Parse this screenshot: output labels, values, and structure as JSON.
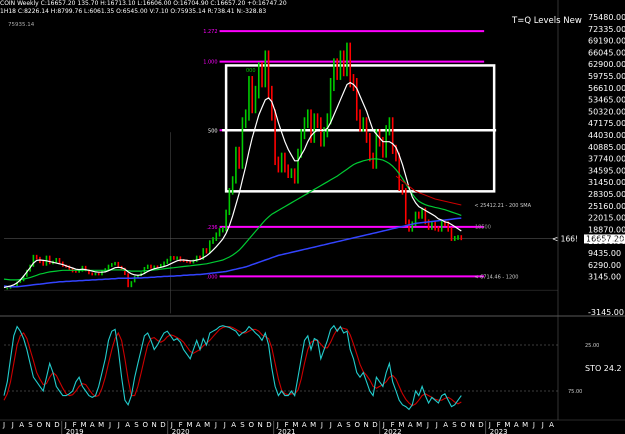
{
  "header": {
    "line1": "COIN Weekly C:16657.20 135.70 H:16713.10 L:16606.00 O:16704.90 C:16657.20 +0:16747.20",
    "line2": "1H18 C:8226.14 H:8799.76 L:6061.35 O:6545.00 V:7.10 O:75935.14 R:738.41 N:-328.83",
    "line3": "75935.14"
  },
  "title_label": "T=Q Levels New",
  "price_axis": {
    "ticks": [
      "75480.00",
      "72335.00",
      "69190.00",
      "66045.00",
      "62900.00",
      "59755.00",
      "56610.00",
      "53465.00",
      "50320.00",
      "47175.00",
      "44030.00",
      "40885.00",
      "37740.00",
      "34595.00",
      "31450.00",
      "28305.00",
      "25160.00",
      "22015.00",
      "18870.00",
      "16657.20",
      "12580.00",
      "9435.00",
      "6290.00",
      "3145.00",
      "-3145.00"
    ],
    "current_price_label": "16657.20",
    "pointer_label": "< 166!"
  },
  "level_labels": {
    "l1272": "1.272",
    "l1000": "1.000",
    "l500": "500",
    "l236": ".236",
    "l000": ".000",
    "misc": "000"
  },
  "annotations": {
    "sma200": "< 25412.21 - 200 SMA",
    "low_level": "< 6714.46 - 1200",
    "box_text": "18500"
  },
  "oscillator": {
    "label": "STO",
    "value": "24.2",
    "ticks": [
      "25.00",
      "75.00"
    ]
  },
  "time_axis": {
    "months": [
      "J",
      "J",
      "A",
      "S",
      "O",
      "N",
      "D",
      "J",
      "F",
      "M",
      "A",
      "M",
      "J",
      "J",
      "A",
      "S",
      "O",
      "N",
      "D",
      "J",
      "F",
      "M",
      "A",
      "M",
      "J",
      "J",
      "A",
      "S",
      "O",
      "N",
      "D",
      "J",
      "F",
      "M",
      "A",
      "M",
      "J",
      "J",
      "A",
      "S",
      "O",
      "N",
      "D",
      "J",
      "F",
      "M",
      "A",
      "M",
      "J",
      "J",
      "A",
      "S",
      "O",
      "N",
      "D",
      "J",
      "F",
      "M",
      "A",
      "M",
      "J",
      "J",
      "A"
    ],
    "years": [
      "2019",
      "2020",
      "2021",
      "2022",
      "2023"
    ]
  },
  "colors": {
    "price_up": "#00cc00",
    "price_down": "#ff0000",
    "sma_fast": "#ffffff",
    "sma_slow": "#00cc33",
    "sma200": "#cc0000",
    "long_ma": "#3344ff",
    "fib": "#ff00ff",
    "stoch_k": "#22cccc",
    "stoch_d": "#cc0000"
  },
  "chart_data": {
    "type": "line",
    "series": [
      {
        "values": [
          3400,
          3600,
          3900,
          4100,
          5200,
          5600,
          6800,
          8200,
          9500,
          12000,
          11500,
          10500,
          9800,
          11800,
          10200,
          10500,
          11200,
          10300,
          9500,
          9300,
          8700,
          8000,
          7900,
          8200,
          9200,
          8300,
          7500,
          7200,
          7400,
          7200,
          8000,
          8600,
          9500,
          9900,
          10200,
          9200,
          8700,
          7300,
          4000,
          5300,
          6600,
          7000,
          7500,
          8900,
          9500,
          9000,
          9300,
          9200,
          9700,
          10300,
          11000,
          11700,
          11400,
          11600,
          10900,
          10800,
          10600,
          10400,
          10800,
          11800,
          11400,
          13700,
          13100,
          15700,
          16500,
          17700,
          18800,
          19100,
          23500,
          29000,
          32000,
          39500,
          36000,
          47000,
          49000,
          57500,
          51000,
          55000,
          61000,
          58000,
          64000,
          55000,
          49000,
          37000,
          35000,
          38000,
          35000,
          33500,
          34000,
          32000,
          39000,
          44000,
          47000,
          49000,
          43000,
          48000,
          47000,
          42000,
          44500,
          48000,
          57000,
          62000,
          60000,
          64000,
          61000,
          66000,
          58000,
          57000,
          49000,
          46000,
          47000,
          43000,
          38000,
          36000,
          44000,
          42000,
          39000,
          45000,
          47000,
          40000,
          38000,
          30000,
          29000,
          21000,
          19000,
          20500,
          23000,
          22500,
          24000,
          21000,
          19500,
          20500,
          19300,
          19000,
          21000,
          20500,
          19000,
          16500,
          16800,
          17000,
          16700
        ]
      },
      {
        "values": [
          3800,
          4000,
          4200,
          4500,
          5000,
          5800,
          6800,
          7900,
          9000,
          10200,
          10900,
          11000,
          10900,
          10800,
          10600,
          10400,
          10200,
          10000,
          9800,
          9500,
          9200,
          8900,
          8600,
          8500,
          8600,
          8500,
          8300,
          8100,
          7900,
          7800,
          7800,
          7900,
          8200,
          8600,
          9000,
          9100,
          9000,
          8600,
          7900,
          7400,
          7100,
          7000,
          7100,
          7500,
          8000,
          8400,
          8700,
          8900,
          9100,
          9300,
          9600,
          10000,
          10400,
          10800,
          11000,
          11000,
          10900,
          10800,
          10800,
          11000,
          11200,
          11600,
          12100,
          12800,
          13600,
          14500,
          15500,
          16500,
          18000,
          20000,
          22500,
          25500,
          28500,
          32000,
          35500,
          39500,
          43000,
          46000,
          49000,
          51000,
          53000,
          53500,
          52500,
          50000,
          47000,
          44500,
          42000,
          40000,
          38500,
          37000,
          37000,
          38500,
          40000,
          42000,
          43500,
          44500,
          45000,
          45000,
          45000,
          45500,
          47000,
          49000,
          51000,
          53000,
          55000,
          57000,
          57500,
          57000,
          56000,
          54000,
          52000,
          50000,
          47500,
          45000,
          44000,
          43000,
          42000,
          42000,
          42000,
          41500,
          40500,
          38500,
          36000,
          33000,
          30000,
          27500,
          26000,
          25000,
          24500,
          24000,
          23500,
          23000,
          22500,
          21800,
          21500,
          21000,
          20800,
          20300,
          19800,
          19200,
          18600
        ]
      },
      {
        "values": [
          6000,
          5900,
          5800,
          5800,
          5800,
          5900,
          6000,
          6200,
          6400,
          6700,
          7000,
          7300,
          7500,
          7700,
          7900,
          8000,
          8100,
          8200,
          8300,
          8300,
          8300,
          8300,
          8300,
          8300,
          8300,
          8300,
          8300,
          8300,
          8300,
          8300,
          8300,
          8300,
          8300,
          8400,
          8400,
          8400,
          8400,
          8300,
          8200,
          8100,
          8100,
          8100,
          8100,
          8200,
          8200,
          8300,
          8400,
          8500,
          8600,
          8700,
          8800,
          8900,
          9000,
          9100,
          9200,
          9300,
          9400,
          9500,
          9600,
          9700,
          9800,
          9900,
          10000,
          10200,
          10400,
          10600,
          10800,
          11000,
          11400,
          11800,
          12300,
          12900,
          13600,
          14500,
          15500,
          16500,
          17500,
          18500,
          19500,
          20500,
          21500,
          22300,
          23000,
          23500,
          24000,
          24500,
          25000,
          25500,
          26000,
          26500,
          27000,
          27500,
          28000,
          28500,
          29000,
          29500,
          30000,
          30500,
          31000,
          31500,
          32000,
          32500,
          33000,
          33600,
          34200,
          34800,
          35400,
          36000,
          36400,
          36700,
          37000,
          37200,
          37400,
          37500,
          37500,
          37400,
          37200,
          36800,
          36300,
          35600,
          34700,
          33600,
          32400,
          31000,
          29600,
          28300,
          27200,
          26400,
          25900,
          25500,
          25200,
          25000,
          24800,
          24600,
          24400,
          24200,
          23900,
          23600,
          23300,
          23000,
          22700
        ]
      },
      {
        "values": [
          4200,
          4100,
          4000,
          4000,
          4000,
          4100,
          4200,
          4300,
          4400,
          4500,
          4600,
          4700,
          4800,
          4900,
          5000,
          5100,
          5200,
          5300,
          5300,
          5400,
          5400,
          5500,
          5500,
          5600,
          5600,
          5700,
          5700,
          5800,
          5800,
          5900,
          5900,
          6000,
          6000,
          6100,
          6100,
          6200,
          6200,
          6200,
          6200,
          6200,
          6300,
          6300,
          6300,
          6400,
          6400,
          6500,
          6500,
          6600,
          6600,
          6700,
          6700,
          6800,
          6800,
          6900,
          6900,
          7000,
          7000,
          7100,
          7100,
          7200,
          7200,
          7300,
          7400,
          7500,
          7600,
          7700,
          7800,
          7900,
          8000,
          8200,
          8400,
          8600,
          8800,
          9000,
          9200,
          9500,
          9800,
          10100,
          10400,
          10700,
          11000,
          11300,
          11600,
          11900,
          12200,
          12400,
          12600,
          12800,
          13000,
          13200,
          13400,
          13600,
          13800,
          14000,
          14200,
          14400,
          14600,
          14800,
          15000,
          15200,
          15400,
          15600,
          15800,
          16000,
          16200,
          16400,
          16600,
          16800,
          17000,
          17200,
          17400,
          17600,
          17800,
          18000,
          18200,
          18400,
          18600,
          18800,
          19000,
          19200,
          19400,
          19600,
          19800,
          20000,
          20200,
          20400,
          20600,
          20700,
          20800,
          20900,
          21000,
          21100,
          21200,
          21300,
          21400,
          21500,
          21600,
          21700,
          21800,
          21900,
          22000
        ]
      }
    ],
    "ylim": [
      -3145,
      75480
    ],
    "fib_levels": [
      {
        "value": 71000,
        "label": "1.272"
      },
      {
        "value": 63000,
        "label": "1.000"
      },
      {
        "value": 45000,
        "label": "500"
      },
      {
        "value": 19700,
        "label": ".236"
      },
      {
        "value": 6700,
        "label": ".000"
      }
    ],
    "boxes": [
      {
        "from_index": 68,
        "to_index": 147,
        "y1": 62000,
        "y2": 29000
      },
      {
        "from_index": 68,
        "to_index": 147,
        "y1": 45000,
        "y2": 45000
      }
    ],
    "stochastic": {
      "k": [
        20,
        35,
        60,
        85,
        95,
        90,
        82,
        70,
        55,
        40,
        35,
        30,
        25,
        40,
        55,
        45,
        30,
        25,
        20,
        20,
        22,
        25,
        35,
        40,
        30,
        25,
        20,
        18,
        20,
        30,
        45,
        60,
        80,
        90,
        92,
        70,
        40,
        15,
        10,
        20,
        40,
        55,
        70,
        85,
        88,
        80,
        70,
        75,
        82,
        88,
        90,
        85,
        80,
        82,
        78,
        70,
        65,
        60,
        70,
        80,
        70,
        82,
        75,
        88,
        90,
        92,
        95,
        96,
        95,
        94,
        92,
        90,
        85,
        88,
        90,
        95,
        92,
        88,
        85,
        80,
        88,
        75,
        50,
        30,
        20,
        25,
        20,
        20,
        25,
        20,
        40,
        60,
        80,
        85,
        70,
        82,
        80,
        60,
        70,
        80,
        92,
        96,
        90,
        95,
        88,
        90,
        70,
        60,
        45,
        40,
        45,
        35,
        25,
        20,
        40,
        35,
        30,
        45,
        55,
        35,
        25,
        15,
        10,
        8,
        5,
        10,
        25,
        20,
        30,
        20,
        12,
        18,
        15,
        12,
        20,
        22,
        15,
        8,
        10,
        15,
        20
      ],
      "d": [
        15,
        22,
        35,
        55,
        75,
        85,
        88,
        82,
        70,
        58,
        45,
        38,
        32,
        33,
        40,
        45,
        42,
        35,
        28,
        22,
        20,
        21,
        25,
        30,
        33,
        32,
        27,
        22,
        19,
        20,
        28,
        40,
        55,
        70,
        82,
        88,
        80,
        60,
        38,
        20,
        20,
        30,
        45,
        60,
        75,
        82,
        83,
        80,
        78,
        80,
        84,
        86,
        85,
        83,
        81,
        78,
        73,
        68,
        66,
        68,
        70,
        74,
        77,
        80,
        84,
        88,
        92,
        94,
        95,
        95,
        94,
        92,
        90,
        88,
        88,
        90,
        92,
        92,
        90,
        86,
        84,
        82,
        72,
        55,
        38,
        26,
        22,
        21,
        22,
        22,
        26,
        38,
        55,
        70,
        78,
        80,
        80,
        76,
        72,
        72,
        78,
        86,
        92,
        94,
        93,
        92,
        86,
        76,
        65,
        54,
        46,
        42,
        37,
        30,
        28,
        30,
        32,
        35,
        40,
        42,
        38,
        30,
        22,
        16,
        12,
        9,
        11,
        15,
        20,
        22,
        20,
        18,
        16,
        15,
        15,
        17,
        18,
        16,
        13,
        11,
        13
      ]
    }
  }
}
